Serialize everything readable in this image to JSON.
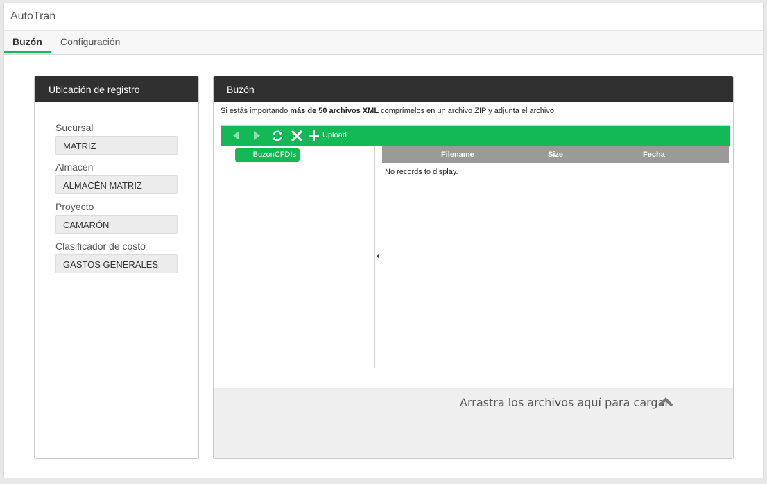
{
  "app": {
    "title": "AutoTran"
  },
  "tabs": [
    {
      "label": "Buzón",
      "active": true
    },
    {
      "label": "Configuración",
      "active": false
    }
  ],
  "location_panel": {
    "title": "Ubicación de registro",
    "fields": [
      {
        "label": "Sucursal",
        "value": "MATRIZ"
      },
      {
        "label": "Almacén",
        "value": "ALMACÉN MATRIZ"
      },
      {
        "label": "Proyecto",
        "value": "CAMARÓN"
      },
      {
        "label": "Clasificador de costo",
        "value": "GASTOS GENERALES"
      }
    ]
  },
  "mailbox_panel": {
    "title": "Buzón",
    "notice_before": "Si estás importando ",
    "notice_bold": "más de 50 archivos XML",
    "notice_after": " comprímelos en un archivo ZIP y adjunta el archivo.",
    "toolbar": {
      "icons": [
        "back-icon",
        "forward-icon",
        "refresh-icon",
        "delete-icon",
        "add-icon"
      ],
      "upload_label": "Upload"
    },
    "tree": {
      "connector": ".....",
      "root": "BuzonCFDIs"
    },
    "grid": {
      "columns": [
        "Filename",
        "Size",
        "Fecha"
      ],
      "empty_text": "No records to display."
    },
    "drop_hint": "Arrastra los archivos aquí para cargar"
  },
  "colors": {
    "accent": "#13b955",
    "header_dark": "#303030",
    "grid_header": "#9a9a9a"
  }
}
